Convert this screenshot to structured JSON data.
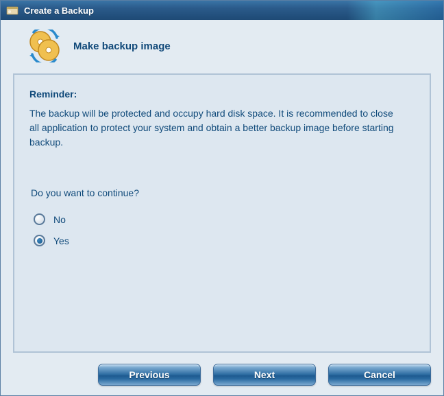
{
  "window": {
    "title": "Create a Backup",
    "heading": "Make backup image"
  },
  "panel": {
    "reminder_label": "Reminder:",
    "reminder_body": "The backup will be protected and occupy hard disk space. It is recommended to close all application to protect your system and obtain a better backup image before starting backup.",
    "question": "Do you want to continue?",
    "options": {
      "no": "No",
      "yes": "Yes",
      "selected": "yes"
    }
  },
  "buttons": {
    "previous": "Previous",
    "next": "Next",
    "cancel": "Cancel"
  }
}
